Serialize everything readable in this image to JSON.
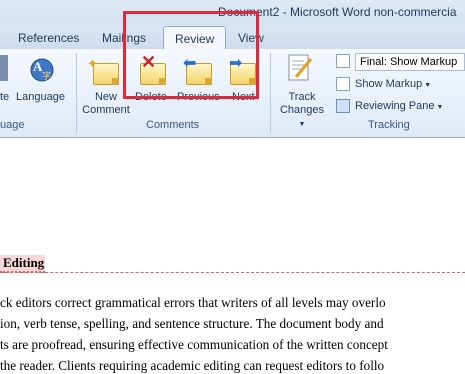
{
  "window": {
    "title": "Document2 - Microsoft Word non-commercia"
  },
  "tabs": [
    {
      "label": "References"
    },
    {
      "label": "Mailings"
    },
    {
      "label": "Review",
      "active": true
    },
    {
      "label": "View"
    }
  ],
  "ribbon": {
    "language_group": {
      "buttons": [
        "te",
        "Language"
      ],
      "label": "uage"
    },
    "comments_group": {
      "new_comment": "New\nComment",
      "delete": "Delete",
      "previous": "Previous",
      "next": "Next",
      "label": "Comments"
    },
    "tracking_group": {
      "track_changes": "Track\nChanges",
      "display_for_review": "Final: Show Markup",
      "show_markup": "Show Markup",
      "reviewing_pane": "Reviewing Pane",
      "label": "Tracking"
    }
  },
  "document": {
    "heading": "Editing",
    "lines": [
      "ck editors correct grammatical errors that writers of all levels may overlo",
      "ion, verb tense, spelling, and sentence structure. The document body and",
      "ts are proofread, ensuring effective communication of the written concept",
      "the reader. Clients requiring academic editing can request editors to follo"
    ]
  },
  "colors": {
    "highlight_box": "#e0283a",
    "ribbon_bg": "#dfe9f5",
    "tab_text": "#1e395b"
  }
}
